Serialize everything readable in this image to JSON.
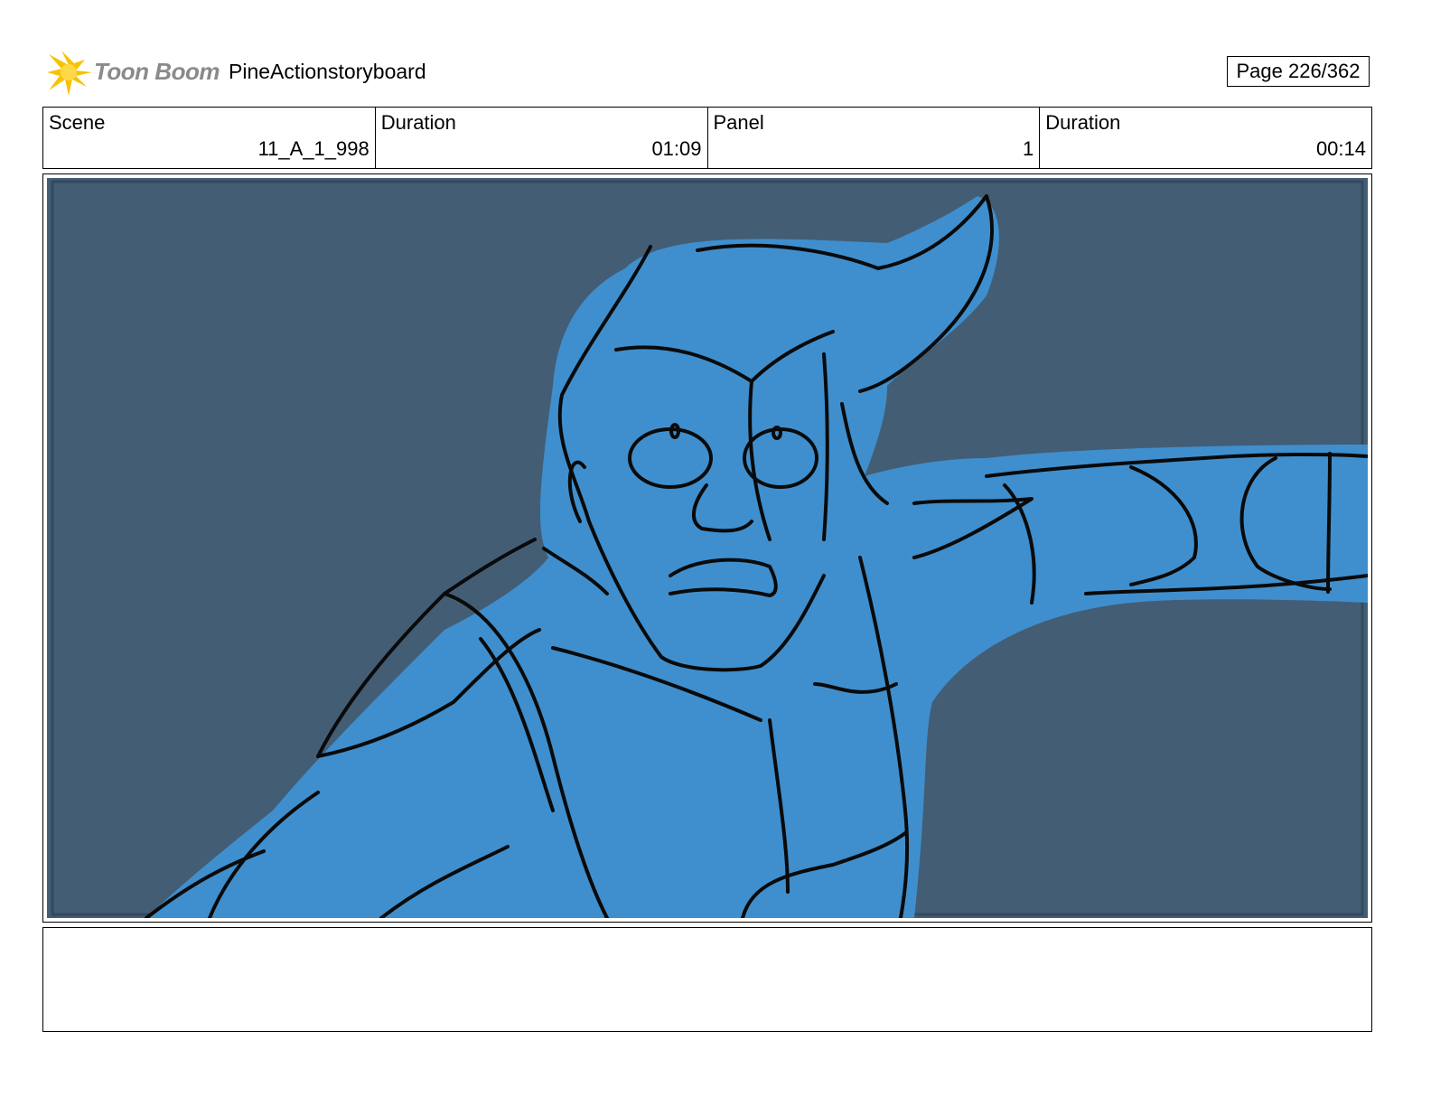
{
  "header": {
    "logo_text": "Toon Boom",
    "logo_icon": "starburst-logo-icon",
    "project_title": "PineActionstoryboard",
    "page_label": "Page 226/362"
  },
  "info": {
    "scene_label": "Scene",
    "scene_value": "11_A_1_998",
    "scene_duration_label": "Duration",
    "scene_duration_value": "01:09",
    "panel_label": "Panel",
    "panel_value": "1",
    "panel_duration_label": "Duration",
    "panel_duration_value": "00:14"
  },
  "colors": {
    "panel_background": "#435d75",
    "character_fill": "#3f8fce",
    "logo_yellow": "#f6c300"
  }
}
